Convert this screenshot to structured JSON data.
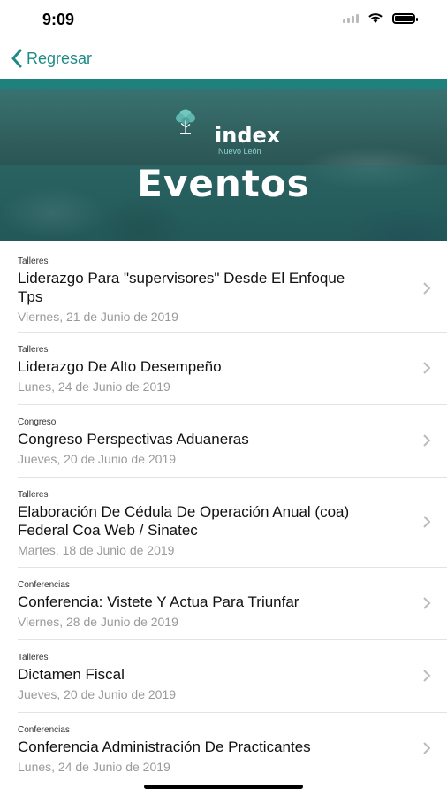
{
  "status": {
    "time": "9:09"
  },
  "nav": {
    "back_label": "Regresar"
  },
  "banner": {
    "logo_text": "index",
    "logo_sub": "Nuevo León",
    "title": "Eventos"
  },
  "events": [
    {
      "category": "Talleres",
      "title": "Liderazgo Para \"supervisores\" Desde El Enfoque Tps",
      "date": "Viernes, 21 de Junio de 2019"
    },
    {
      "category": "Talleres",
      "title": "Liderazgo De Alto Desempeño",
      "date": "Lunes, 24 de Junio de 2019"
    },
    {
      "category": "Congreso",
      "title": "Congreso Perspectivas Aduaneras",
      "date": "Jueves, 20 de Junio de 2019"
    },
    {
      "category": "Talleres",
      "title": "Elaboración De Cédula De Operación Anual (coa) Federal Coa Web / Sinatec",
      "date": "Martes, 18 de Junio de 2019"
    },
    {
      "category": "Conferencias",
      "title": "Conferencia: Vistete Y Actua Para Triunfar",
      "date": "Viernes, 28 de Junio de 2019"
    },
    {
      "category": "Talleres",
      "title": "Dictamen Fiscal",
      "date": "Jueves, 20 de Junio de 2019"
    },
    {
      "category": "Conferencias",
      "title": "Conferencia Administración De Practicantes",
      "date": "Lunes, 24 de Junio de 2019"
    }
  ],
  "colors": {
    "accent": "#1e8a87",
    "muted": "#9a9a9a"
  },
  "icons": {
    "back": "chevron-left-icon",
    "row": "chevron-right-icon"
  }
}
